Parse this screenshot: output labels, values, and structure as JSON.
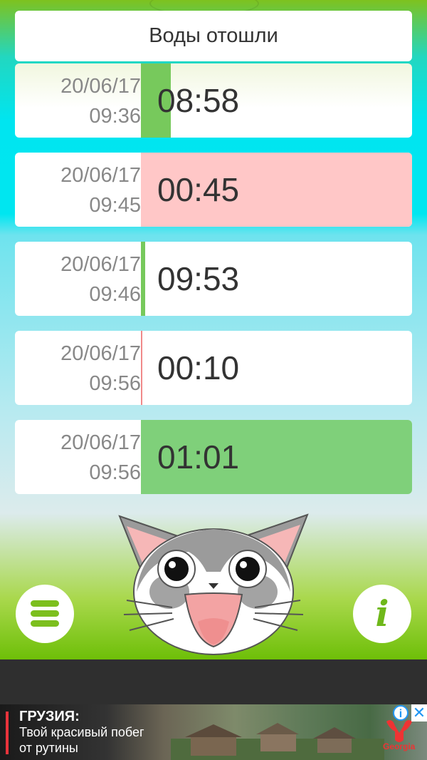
{
  "header": {
    "title": "Воды отошли"
  },
  "rows": [
    {
      "date": "20/06/17",
      "time": "09:36",
      "duration": "08:58",
      "fill_fraction": 0.11,
      "fill_color": "#77c95c"
    },
    {
      "date": "20/06/17",
      "time": "09:45",
      "duration": "00:45",
      "fill_fraction": 1.0,
      "fill_color": "#ffc7c7"
    },
    {
      "date": "20/06/17",
      "time": "09:46",
      "duration": "09:53",
      "fill_fraction": 0.015,
      "fill_color": "#77c95c"
    },
    {
      "date": "20/06/17",
      "time": "09:56",
      "duration": "00:10",
      "fill_fraction": 0.004,
      "fill_color": "#f08a8a"
    },
    {
      "date": "20/06/17",
      "time": "09:56",
      "duration": "01:01",
      "fill_fraction": 1.0,
      "fill_color": "#7fd07a"
    }
  ],
  "controls": {
    "menu_icon": "hamburger-menu-icon",
    "info_icon": "info-icon",
    "info_glyph": "i"
  },
  "ad": {
    "headline": "ГРУЗИЯ:",
    "line1": "Твой красивый побег",
    "line2": "от рутины",
    "brand": "Georgia",
    "adchoices_glyph": "i",
    "close_glyph": "✕"
  },
  "colors": {
    "accent_green": "#6fb81a",
    "ad_accent": "#e8333b"
  }
}
